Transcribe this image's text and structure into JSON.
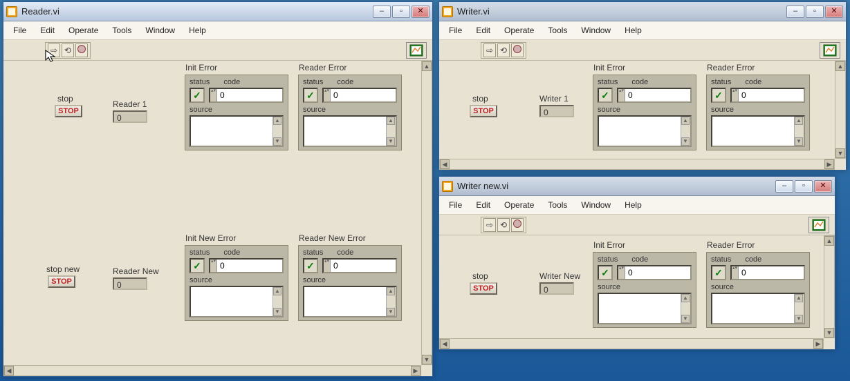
{
  "menus": {
    "file": "File",
    "edit": "Edit",
    "operate": "Operate",
    "tools": "Tools",
    "window": "Window",
    "help": "Help"
  },
  "winbtns": {
    "min": "–",
    "max": "▫",
    "close": "✕"
  },
  "scroll": {
    "up": "▲",
    "dn": "▼",
    "lt": "◀",
    "rt": "▶"
  },
  "error": {
    "status_label": "status",
    "code_label": "code",
    "source_label": "source",
    "check": "✓",
    "code_default": "0",
    "spin": "▴▾"
  },
  "windows": {
    "reader": {
      "title": "Reader.vi",
      "row1": {
        "stop_label": "stop",
        "stop_text": "STOP",
        "ind_label": "Reader 1",
        "ind_value": "0",
        "err1_title": "Init Error",
        "err2_title": "Reader Error"
      },
      "row2": {
        "stop_label": "stop new",
        "stop_text": "STOP",
        "ind_label": "Reader New",
        "ind_value": "0",
        "err1_title": "Init New Error",
        "err2_title": "Reader New Error"
      }
    },
    "writer": {
      "title": "Writer.vi",
      "stop_label": "stop",
      "stop_text": "STOP",
      "ind_label": "Writer 1",
      "ind_value": "0",
      "err1_title": "Init Error",
      "err2_title": "Reader Error"
    },
    "writernew": {
      "title": "Writer new.vi",
      "stop_label": "stop",
      "stop_text": "STOP",
      "ind_label": "Writer New",
      "ind_value": "0",
      "err1_title": "Init Error",
      "err2_title": "Reader Error"
    }
  }
}
